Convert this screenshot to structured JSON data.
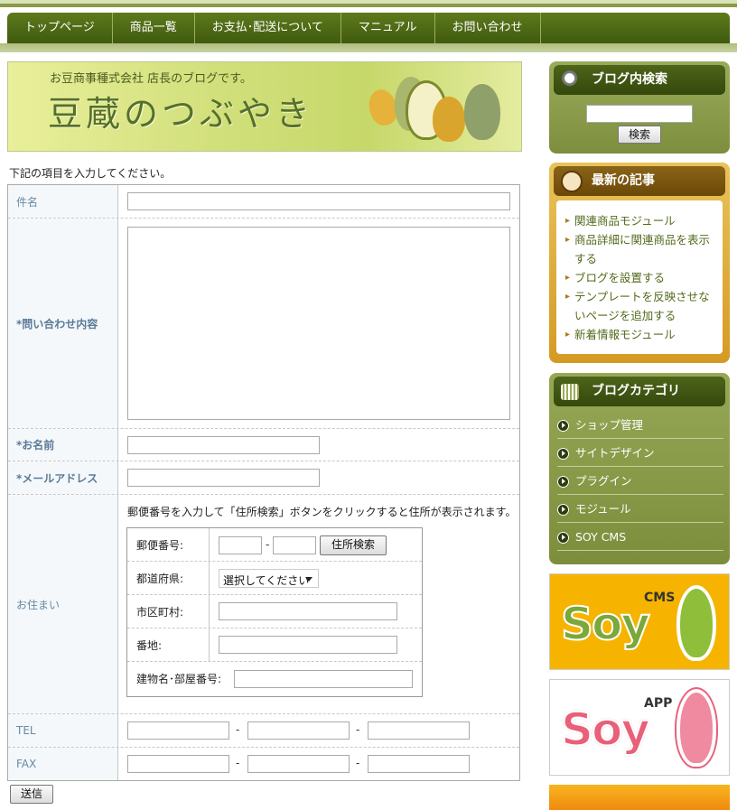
{
  "nav": {
    "items": [
      "トップページ",
      "商品一覧",
      "お支払･配送について",
      "マニュアル",
      "お問い合わせ"
    ]
  },
  "banner": {
    "subtitle": "お豆商事種式会社 店長のブログです。",
    "title": "豆蔵のつぶやき"
  },
  "form": {
    "intro": "下記の項目を入力してください。",
    "subject_label": "件名",
    "message_label": "*問い合わせ内容",
    "name_label": "*お名前",
    "email_label": "*メールアドレス",
    "address_label": "お住まい",
    "address_note": "郵便番号を入力して「住所検索」ボタンをクリックすると住所が表示されます。",
    "zip_label": "郵便番号:",
    "zip_separator": "-",
    "zip_search_button": "住所検索",
    "pref_label": "都道府県:",
    "pref_select": "選択してください",
    "city_label": "市区町村:",
    "street_label": "番地:",
    "building_label": "建物名･部屋番号:",
    "tel_label": "TEL",
    "fax_label": "FAX",
    "phone_separator": "-",
    "submit": "送信"
  },
  "sidebar": {
    "search_title": "ブログ内検索",
    "search_button": "検索",
    "recent_title": "最新の記事",
    "recent_items": [
      "関連商品モジュール",
      "商品詳細に関連商品を表示する",
      "ブログを設置する",
      "テンプレートを反映させないページを追加する",
      "新着情報モジュール"
    ],
    "category_title": "ブログカテゴリ",
    "categories": [
      "ショップ管理",
      "サイトデザイン",
      "プラグイン",
      "モジュール",
      "SOY CMS"
    ]
  },
  "ads": {
    "cms_word": "Soy",
    "cms_tag": "CMS",
    "app_word": "Soy",
    "app_tag": "APP"
  },
  "colors": {
    "nav_bg": "#4d6a16",
    "sidebar_green": "#8c9d4c",
    "sidebar_orange": "#d89a22",
    "soy_cms_bg": "#f6b400",
    "soy_app_bg": "#ffffff",
    "soy_pink": "#e8607a"
  }
}
